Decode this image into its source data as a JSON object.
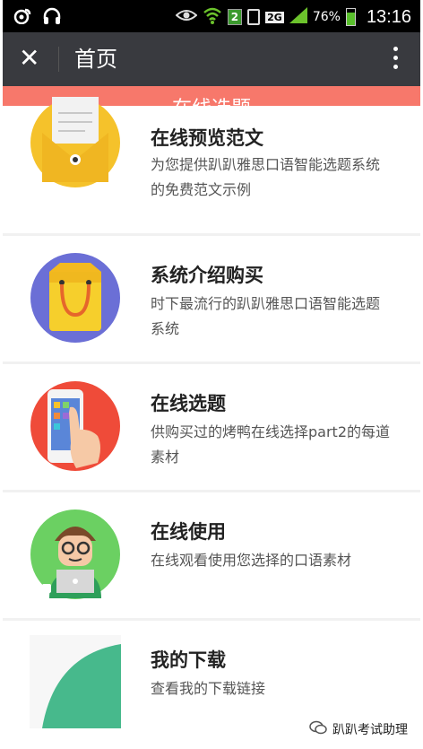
{
  "statusbar": {
    "left_icons": [
      "weibo-icon",
      "headphones-icon"
    ],
    "right_icons": [
      "eye-icon",
      "wifi-icon",
      "sim-icon",
      "signal-icon"
    ],
    "sim_badge": "2",
    "network": "2G",
    "battery": "76%",
    "battery_level": 0.76,
    "time": "13:16"
  },
  "titlebar": {
    "title": "首页",
    "close_icon": "close-icon",
    "more_icon": "more-vertical-icon"
  },
  "banner": {
    "label": "在线选题",
    "color": "#f7786b"
  },
  "items": [
    {
      "title": "在线预览范文",
      "desc": "为您提供趴趴雅思口语智能选题系统的免费范文示例",
      "icon": "envelope-icon"
    },
    {
      "title": "系统介绍购买",
      "desc": "时下最流行的趴趴雅思口语智能选题系统",
      "icon": "shopping-bag-icon"
    },
    {
      "title": "在线选题",
      "desc": "供购买过的烤鸭在线选择part2的每道素材",
      "icon": "phone-hand-icon"
    },
    {
      "title": "在线使用",
      "desc": "在线观看使用您选择的口语素材",
      "icon": "person-laptop-icon"
    },
    {
      "title": "我的下载",
      "desc": "查看我的下载链接",
      "icon": "download-icon"
    }
  ],
  "watermark": {
    "text": "趴趴考试助理",
    "icon": "wechat-icon"
  }
}
